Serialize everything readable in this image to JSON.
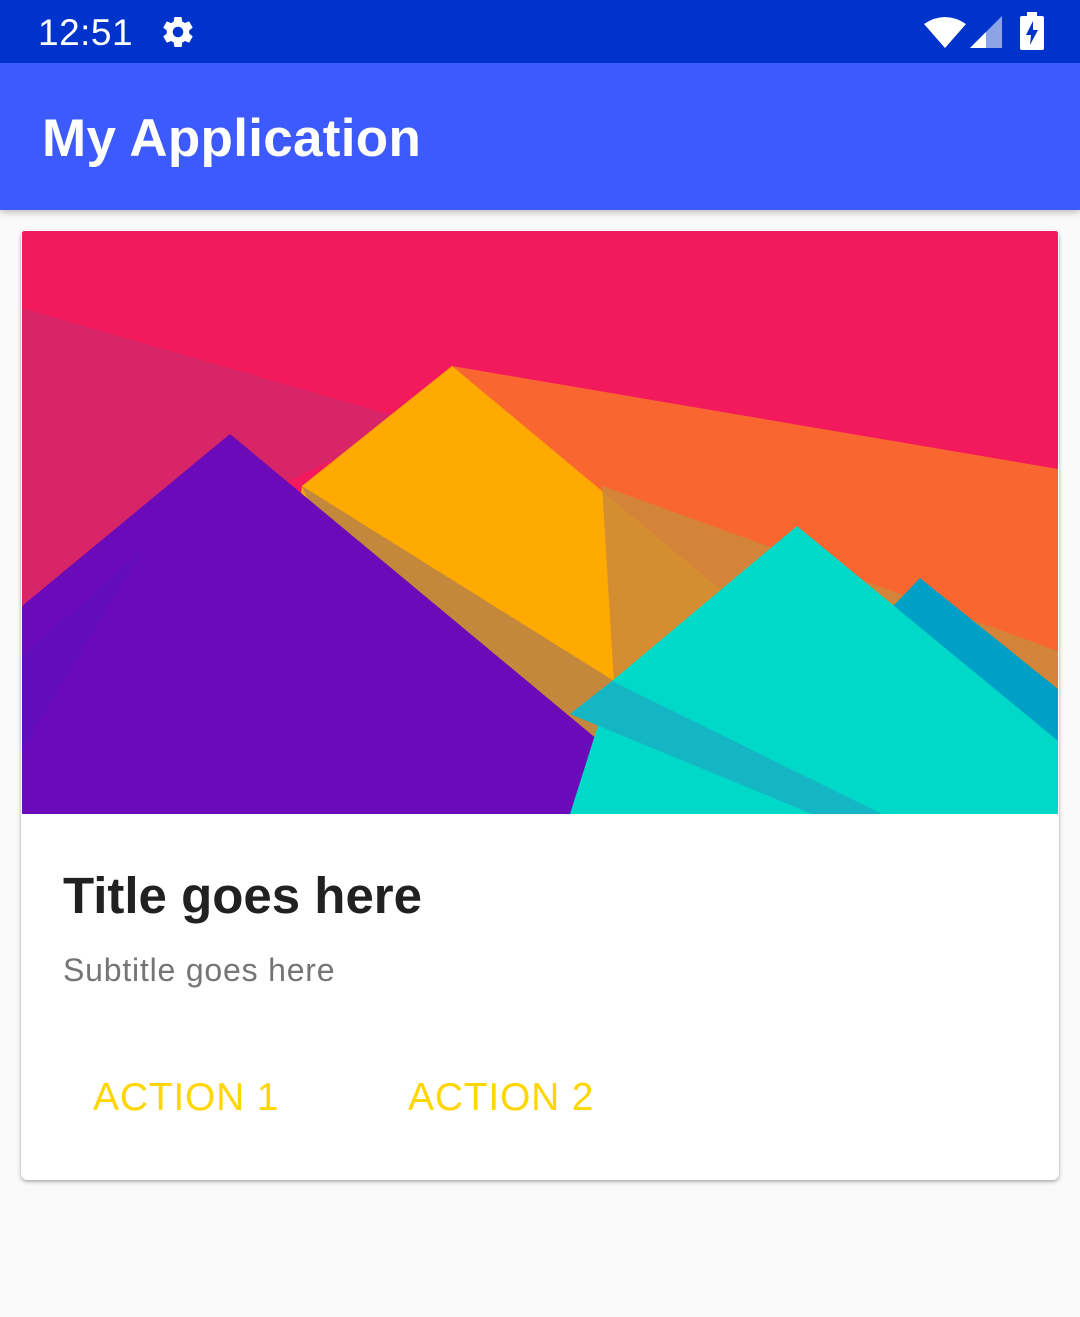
{
  "status_bar": {
    "time": "12:51",
    "icons": [
      "gear-icon",
      "wifi-icon",
      "cell-signal-icon",
      "battery-charging-icon"
    ],
    "background": "#0033cc"
  },
  "app_bar": {
    "title": "My Application",
    "background": "#3d5afe"
  },
  "card": {
    "image": "material-mountains-illustration",
    "title": "Title goes here",
    "subtitle": "Subtitle goes here",
    "actions": [
      {
        "label": "ACTION 1"
      },
      {
        "label": "ACTION 2"
      }
    ],
    "action_color": "#ffd600"
  }
}
